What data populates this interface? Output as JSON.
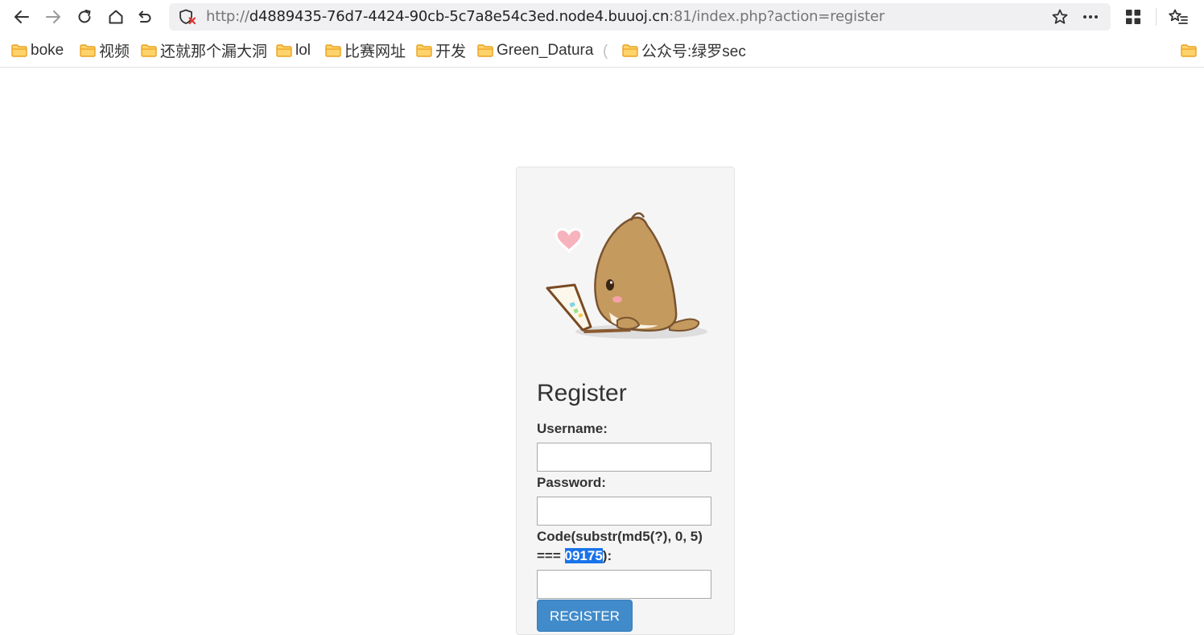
{
  "browser": {
    "url_scheme": "http://",
    "url_host": "d4889435-76d7-4424-90cb-5c7a8e54c3ed.node4.buuoj.cn",
    "url_rest": ":81/index.php?action=register"
  },
  "bookmarks": [
    {
      "label": "boke"
    },
    {
      "label": "视频"
    },
    {
      "label": "还就那个漏大洞"
    },
    {
      "label": "lol"
    },
    {
      "label": "比赛网址"
    },
    {
      "label": "开发"
    },
    {
      "label": "Green_Datura"
    },
    {
      "label": "公众号:绿罗sec"
    }
  ],
  "bookmark_separator": "(",
  "form": {
    "title": "Register",
    "username_label": "Username:",
    "password_label": "Password:",
    "code_label_prefix": "Code(substr(md5(?), 0, 5)",
    "code_label_mid": "=== ",
    "code_value": "09175",
    "code_label_suffix": "):",
    "submit_label": "REGISTER"
  },
  "colors": {
    "accent_button": "#428bca",
    "selection": "#1a73e8",
    "folder": "#f5b83d"
  }
}
